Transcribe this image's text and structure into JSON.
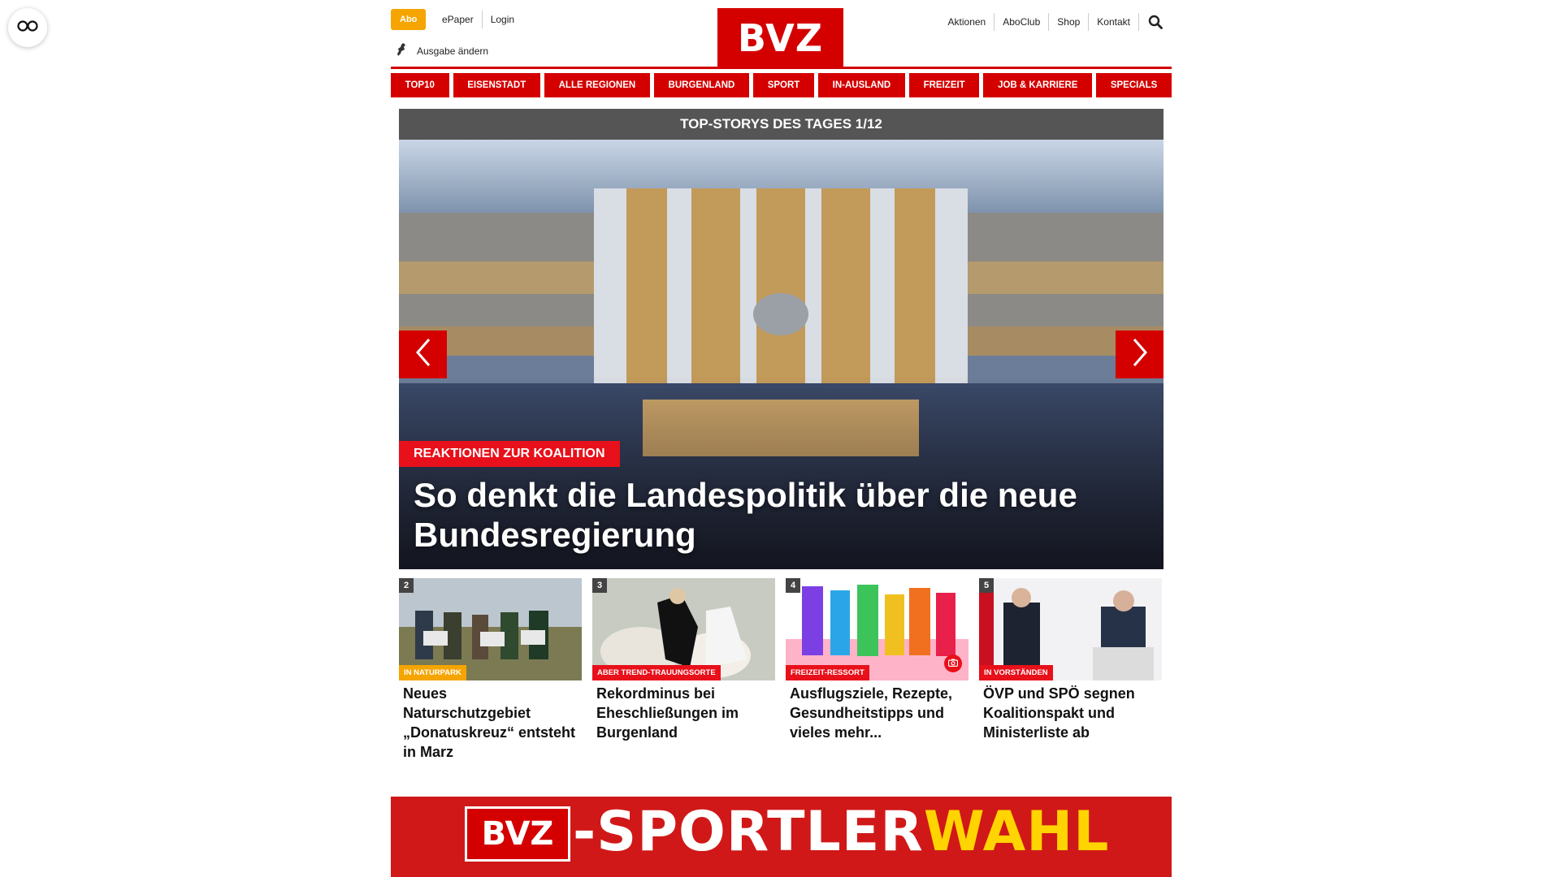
{
  "accessibility": {
    "icon": "glasses-icon"
  },
  "header": {
    "abo": "Abo",
    "left_links": [
      "ePaper",
      "Login"
    ],
    "edition": "Ausgabe ändern",
    "logo": "BVZ",
    "right_links": [
      "Aktionen",
      "AboClub",
      "Shop",
      "Kontakt"
    ]
  },
  "nav": [
    "TOP10",
    "EISENSTADT",
    "ALLE REGIONEN",
    "BURGENLAND",
    "SPORT",
    "IN-AUSLAND",
    "FREIZEIT",
    "JOB & KARRIERE",
    "SPECIALS"
  ],
  "hero": {
    "title": "TOP-STORYS DES TAGES 1/12",
    "tag": "REAKTIONEN ZUR KOALITION",
    "headline": "So denkt die Landespolitik über die neue Bundesregierung"
  },
  "cards": [
    {
      "num": "2",
      "tag": "IN NATURPARK",
      "tag_color": "#f5a400",
      "title": "Neues Naturschutzgebiet „Donatuskreuz“ entsteht in Marz"
    },
    {
      "num": "3",
      "tag": "ABER TREND-TRAUUNGSORTE",
      "tag_color": "#e8101a",
      "title": "Rekordminus bei Eheschließungen im Burgenland"
    },
    {
      "num": "4",
      "tag": "FREIZEIT-RESSORT",
      "tag_color": "#e8101a",
      "title": "Ausflugsziele, Rezepte, Gesundheitstipps und vieles mehr..."
    },
    {
      "num": "5",
      "tag": "IN VORSTÄNDEN",
      "tag_color": "#e8101a",
      "title": "ÖVP und SPÖ segnen Koalitionspakt und Ministerliste ab"
    }
  ],
  "banner": {
    "logo": "BVZ",
    "text_main": "-SPORTLER",
    "text_highlight": "WAHL"
  },
  "colors": {
    "brand_red": "#d40000",
    "accent_orange": "#f5a400"
  }
}
